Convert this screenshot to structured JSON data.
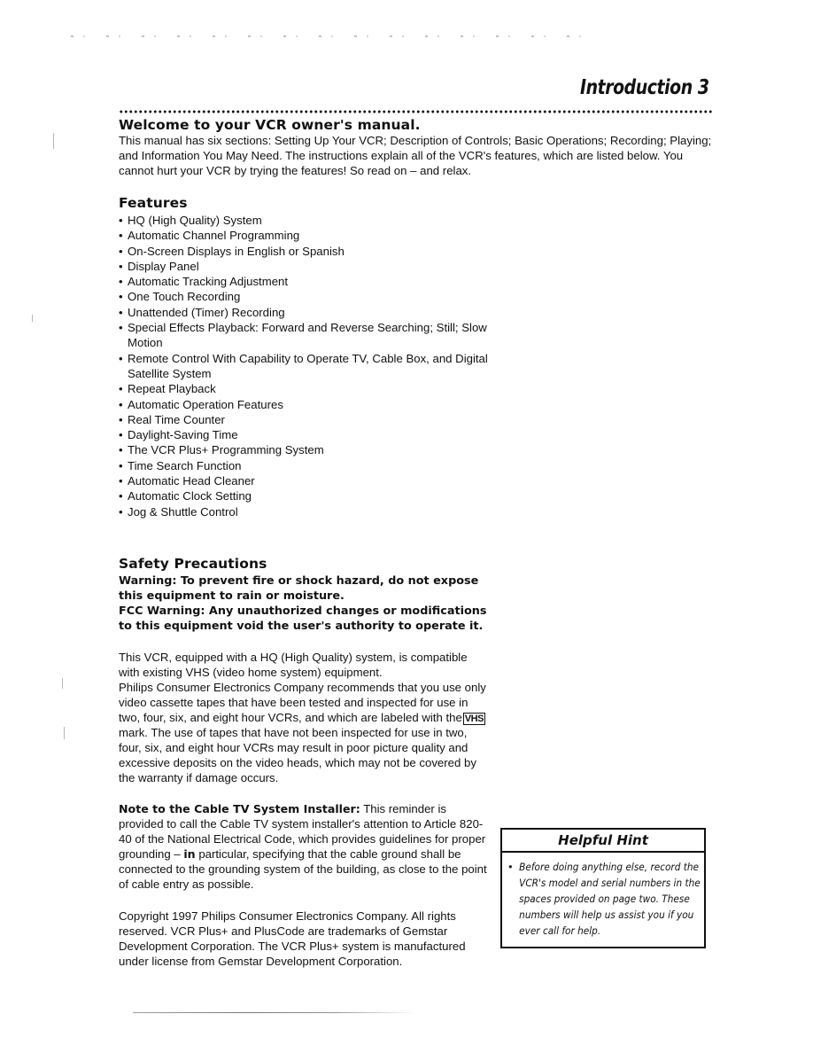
{
  "page": {
    "running_head": "Introduction 3"
  },
  "welcome": {
    "heading": "Welcome to your VCR owner's manual.",
    "body": "This manual has six sections: Setting Up Your VCR; Description of Controls; Basic Operations; Recording; Playing; and Information You May Need. The instructions explain all of the VCR's features, which are listed below. You cannot hurt your VCR by trying the features! So read on – and relax."
  },
  "features": {
    "heading": "Features",
    "items": [
      "HQ (High Quality) System",
      "Automatic Channel Programming",
      "On-Screen Displays in English or Spanish",
      "Display Panel",
      "Automatic Tracking Adjustment",
      "One Touch Recording",
      "Unattended (Timer) Recording",
      "Special Effects Playback: Forward and Reverse Searching; Still; Slow Motion",
      "Remote Control With Capability to Operate TV, Cable Box, and Digital Satellite System",
      "Repeat Playback",
      "Automatic Operation Features",
      "Real Time Counter",
      "Daylight-Saving Time",
      "The VCR Plus+ Programming System",
      "Time Search Function",
      "Automatic Head Cleaner",
      "Automatic Clock Setting",
      "Jog & Shuttle Control"
    ]
  },
  "safety": {
    "heading": "Safety Precautions",
    "warning": "Warning: To prevent fire or shock hazard, do not expose this equipment to rain or moisture.",
    "fcc_warning": "FCC Warning: Any unauthorized changes or modifications to this equipment void the user's authority to operate it."
  },
  "compatibility": {
    "para1": "This VCR, equipped with a HQ (High Quality) system, is compatible with existing VHS (video home system) equipment.",
    "para2_before_logo": "Philips Consumer Electronics Company recommends that you use only video cassette tapes that have been tested and inspected for use in two, four, six, and eight hour VCRs, and which are labeled with the",
    "vhs_logo": "VHS",
    "para2_after_logo": "mark. The use of tapes that have not been inspected for use in two, four, six, and eight hour VCRs may result in poor picture quality and excessive deposits on the video heads, which may not be covered by the warranty if damage occurs."
  },
  "cable_note": {
    "label": "Note to the Cable TV System Installer:",
    "body_before_bold": "This reminder is provided to call the Cable TV system installer's attention to Article 820-40 of the National Electrical Code, which provides guidelines for proper grounding –",
    "bold_phrase": "in",
    "body_after_bold": "particular, specifying that the cable ground shall be connected to the grounding system of the building, as close to the point of cable entry as possible."
  },
  "copyright": {
    "text": "Copyright 1997 Philips Consumer Electronics Company. All rights reserved. VCR Plus+ and PlusCode are trademarks of Gemstar Development Corporation. The VCR Plus+ system is manufactured under license from Gemstar Development Corporation."
  },
  "helpful_hint": {
    "title": "Helpful Hint",
    "bullet": "•",
    "text": "Before doing anything else, record the VCR's model and serial numbers in the spaces provided on page two. These numbers will help us assist you if you ever call for help."
  }
}
